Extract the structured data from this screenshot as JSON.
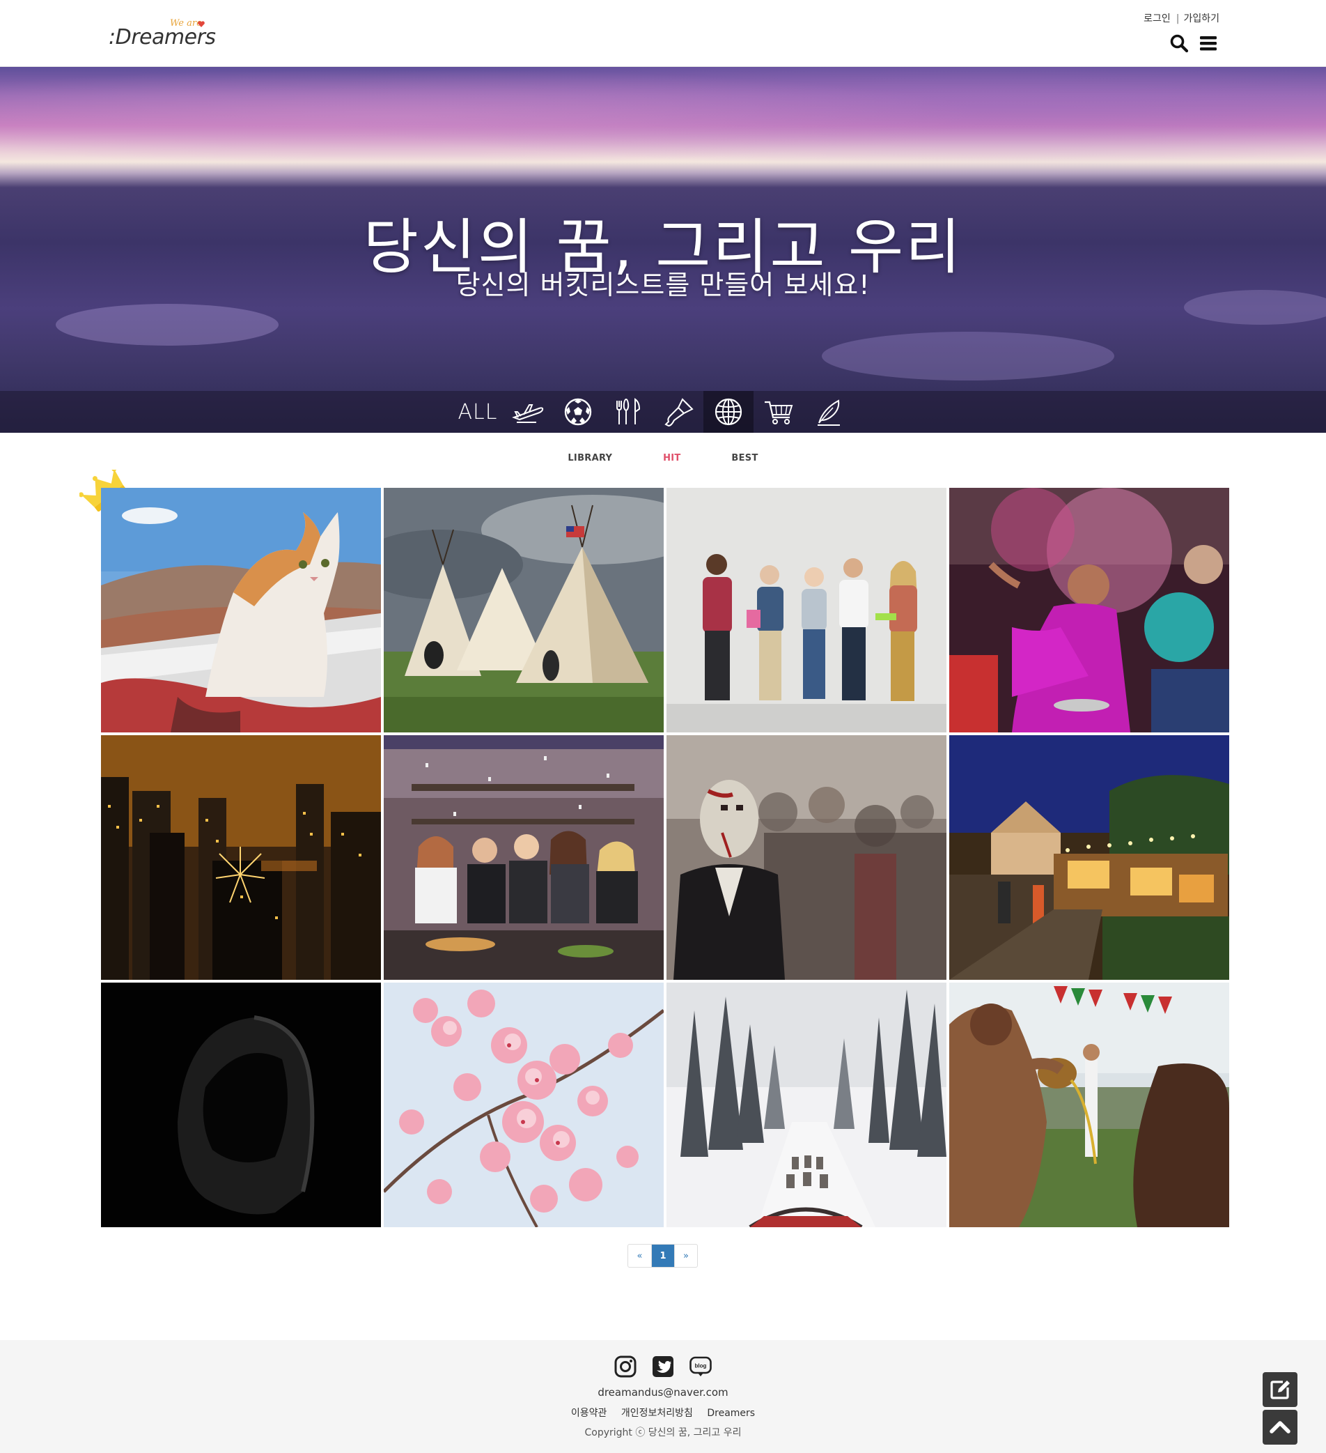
{
  "header": {
    "logo_small": "We are",
    "logo_main": ":Dreamers",
    "login_label": "로그인",
    "separator": "|",
    "signup_label": "가입하기"
  },
  "hero": {
    "title": "당신의 꿈, 그리고 우리",
    "subtitle": "당신의 버킷리스트를 만들어 보세요!"
  },
  "categories": {
    "all_label": "ALL",
    "items": [
      "airplane-icon",
      "soccer-ball-icon",
      "utensils-icon",
      "paintbrush-icon",
      "globe-icon",
      "shopping-cart-icon",
      "feather-pen-icon"
    ],
    "active": "globe-icon"
  },
  "tabs": {
    "library": "LIBRARY",
    "hit": "HIT",
    "best": "BEST",
    "active": "HIT",
    "active_color": "#e0506a"
  },
  "gallery": {
    "items": [
      "cat-on-rooftop-photo",
      "tipi-tents-photo",
      "friends-group-photo",
      "color-festival-photo",
      "city-fireworks-photo",
      "party-toast-photo",
      "zombie-crowd-photo",
      "christmas-market-photo",
      "hooded-figure-photo",
      "cherry-blossom-photo",
      "dog-sled-forest-photo",
      "oil-wrestling-photo"
    ]
  },
  "pagination": {
    "prev": "«",
    "current": "1",
    "next": "»"
  },
  "footer": {
    "email": "dreamandus@naver.com",
    "terms": "이용약관",
    "privacy": "개인정보처리방침",
    "brand": "Dreamers",
    "copyright": "Copyright ⓒ 당신의 꿈, 그리고 우리",
    "blog_icon_text": "blog"
  },
  "colors": {
    "accent": "#e0506a",
    "pager_blue": "#337ab7",
    "float_button": "#3a3a3a"
  }
}
